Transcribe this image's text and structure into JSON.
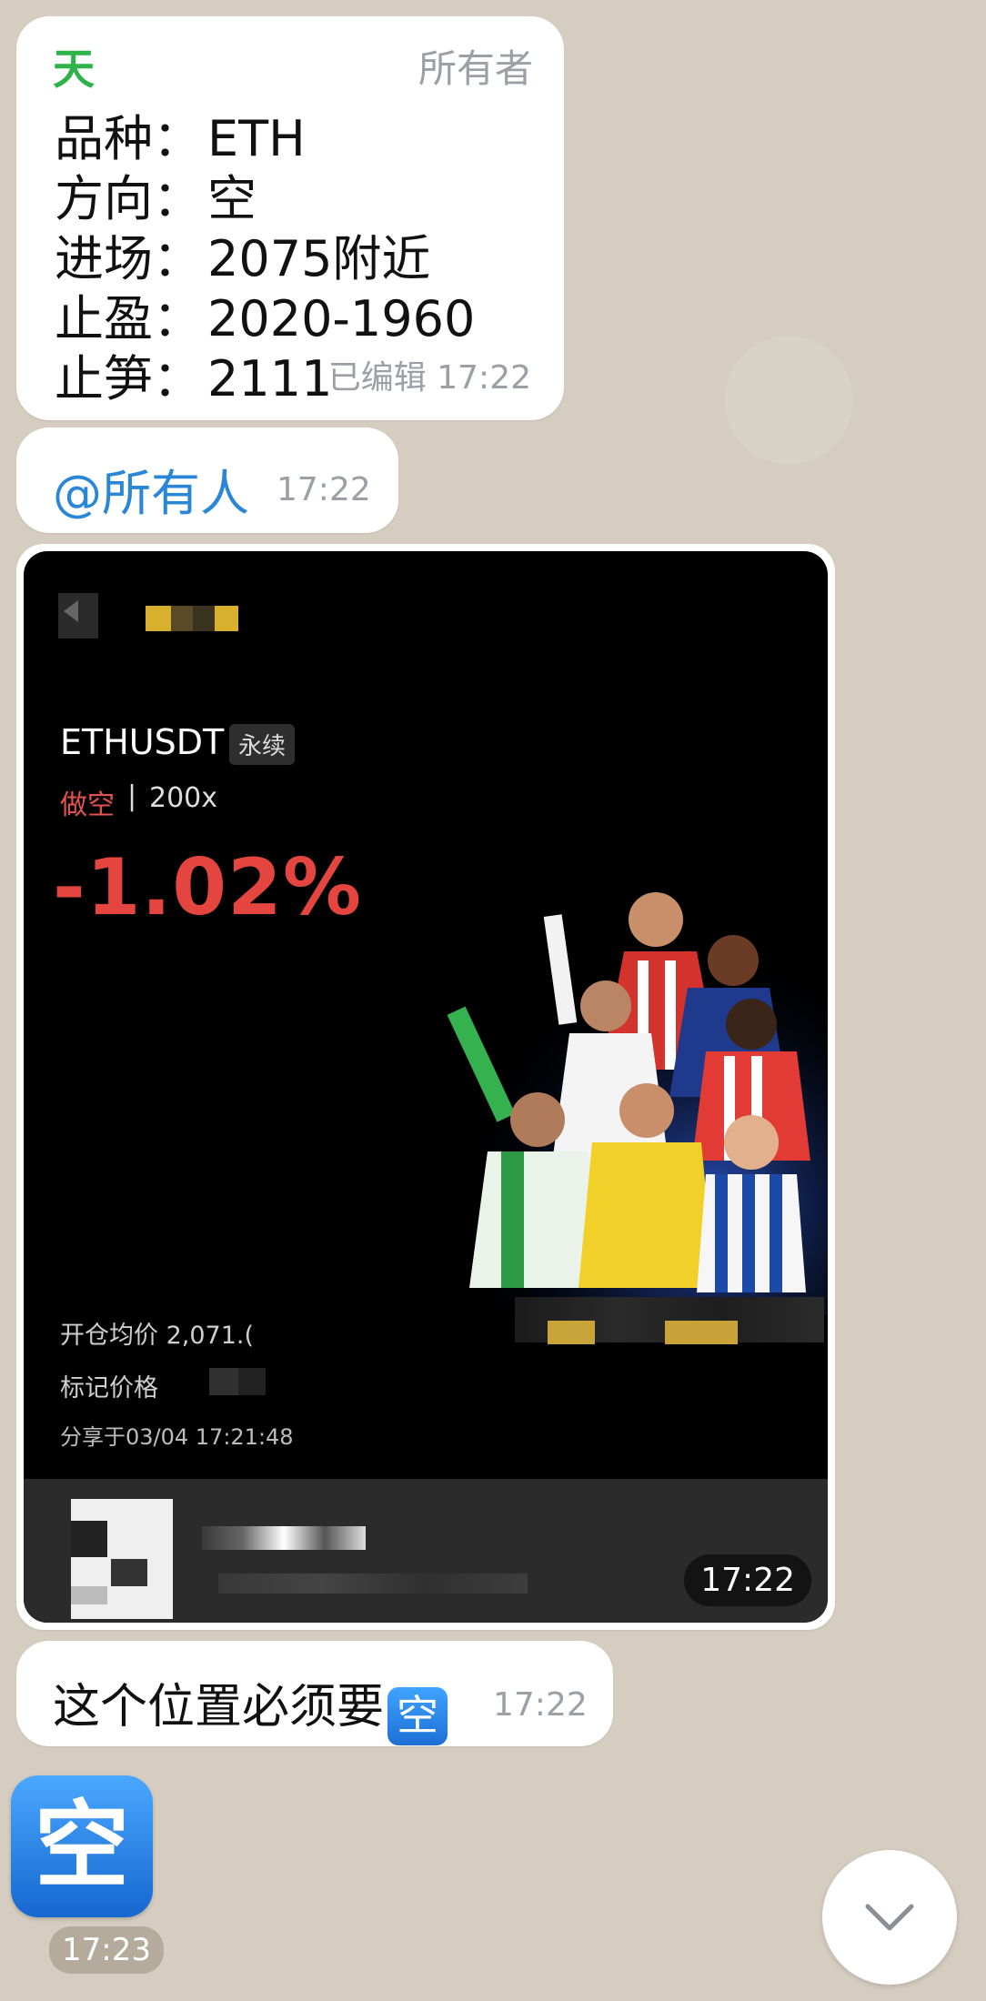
{
  "messages": {
    "signal": {
      "sender": "天",
      "role": "所有者",
      "lines": [
        {
          "label": "品种：",
          "value": "ETH"
        },
        {
          "label": "方向：",
          "value": "空"
        },
        {
          "label": "进场：",
          "value": "2075附近"
        },
        {
          "label": "止盈：",
          "value": "2020-1960"
        },
        {
          "label": "止笋：",
          "value": "2111"
        }
      ],
      "edited": "已编辑",
      "time": "17:22"
    },
    "mention": {
      "text": "@所有人",
      "time": "17:22"
    },
    "image": {
      "symbol": "ETHUSDT",
      "tag": "永续",
      "direction": "做空",
      "separator": "|",
      "leverage": "200x",
      "pnl": "-1.02%",
      "avg_open_label": "开仓均价",
      "avg_open_value": "2,071.(",
      "mark_price_label": "标记价格",
      "shared_at": "分享于03/04 17:21:48",
      "time": "17:22"
    },
    "text": {
      "body": "这个位置必须要",
      "emoji": "空",
      "time": "17:22"
    },
    "sticker": {
      "glyph": "空",
      "time": "17:23"
    }
  },
  "icons": {
    "scroll_down": "chevron-down-icon"
  },
  "colors": {
    "sender_green": "#2db34a",
    "mention_blue": "#2a86d7",
    "short_red": "#e4463f",
    "emoji_blue": "#1d6fd6"
  }
}
